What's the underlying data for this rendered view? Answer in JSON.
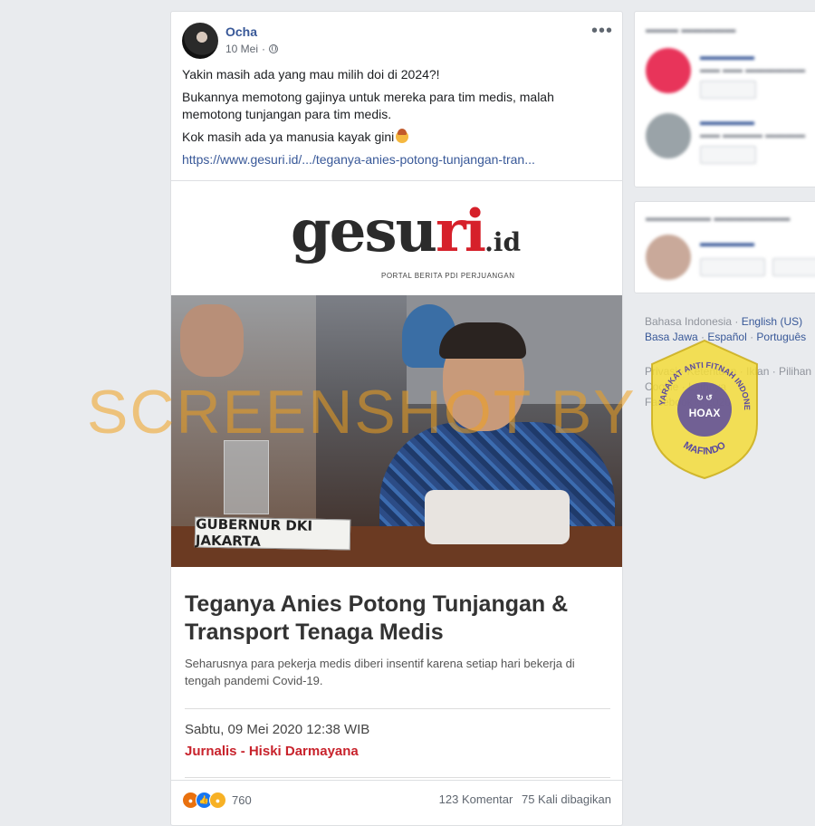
{
  "post": {
    "author": "Ocha",
    "date": "10 Mei",
    "lines": [
      "Yakin masih ada yang mau milih doi di 2024?!",
      "Bukannya memotong gajinya untuk mereka para tim medis, malah memotong tunjangan para tim medis.",
      "Kok masih ada ya manusia kayak gini"
    ],
    "link": "https://www.gesuri.id/.../teganya-anies-potong-tunjangan-tran..."
  },
  "card": {
    "logo_main": "gesu",
    "logo_accent": "ri",
    "logo_suffix": ".id",
    "tagline": "PORTAL BERITA PDI PERJUANGAN",
    "nameplate": "GUBERNUR DKI JAKARTA",
    "headline": "Teganya Anies Potong Tunjangan & Transport Tenaga Medis",
    "summary": "Seharusnya para pekerja medis diberi insentif karena setiap hari bekerja di tengah pandemi Covid-19.",
    "date": "Sabtu, 09 Mei 2020 12:38 WIB",
    "journalist": "Jurnalis - Hiski Darmayana"
  },
  "footer": {
    "reaction_count": "760",
    "comments": "123 Komentar",
    "shares": "75 Kali dibagikan"
  },
  "languages": {
    "current": "Bahasa Indonesia",
    "options": [
      "English (US)",
      "Basa Jawa",
      "Español",
      "Português"
    ]
  },
  "legal": {
    "line1": "Privasi · Ketentuan · Iklan · Pilihan",
    "line2": "Cookie · Lainnya",
    "copyright": "Facebook © 2020"
  },
  "watermark": "SCREENSHOT BY",
  "badge": {
    "top_text": "MASYARAKAT ANTI FITNAH INDONESIA",
    "center_text": "HOAX",
    "bottom_text": "MAFINDO"
  },
  "colors": {
    "fb_blue": "#385898",
    "brand_red": "#c8232c",
    "watermark": "#f0a01e",
    "badge_yellow": "#f3dc3a",
    "badge_purple": "#5a4aa0"
  }
}
